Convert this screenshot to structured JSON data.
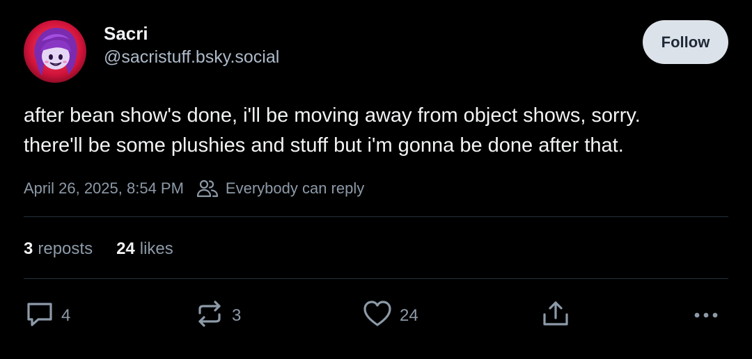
{
  "post": {
    "author": {
      "display_name": "Sacri",
      "handle": "@sacristuff.bsky.social"
    },
    "follow_label": "Follow",
    "text_lines": [
      "after bean show's done, i'll be moving away from object shows, sorry.",
      "there'll be some plushies and stuff but i'm gonna be done after that."
    ],
    "timestamp": "April 26, 2025, 8:54 PM",
    "reply_setting": "Everybody can reply",
    "stats": {
      "reposts_count": "3",
      "reposts_label": "reposts",
      "likes_count": "24",
      "likes_label": "likes"
    },
    "actions": {
      "reply_count": "4",
      "repost_count": "3",
      "like_count": "24"
    },
    "icons": {
      "reply": "speech-bubble-icon",
      "repost": "repost-arrows-icon",
      "like": "heart-icon",
      "share": "share-upload-icon",
      "more": "more-dots-icon",
      "reply_setting": "people-icon"
    },
    "colors": {
      "background": "#000000",
      "text": "#f1f3f5",
      "muted": "#8d9aa8",
      "follow_bg": "#dce2ea",
      "follow_text": "#1f2a37",
      "divider": "#26303b"
    }
  }
}
